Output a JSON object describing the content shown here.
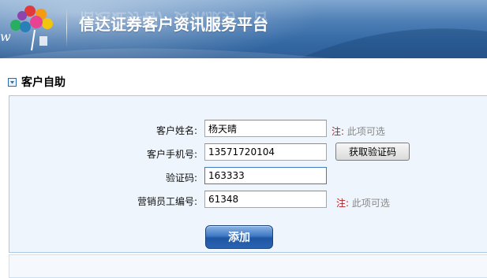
{
  "header": {
    "title": "信达证券客户资讯服务平台"
  },
  "section": {
    "title": "客户自助"
  },
  "form": {
    "name_label": "客户姓名:",
    "name_value": "杨天晴",
    "phone_label": "客户手机号:",
    "phone_value": "13571720104",
    "code_label": "验证码:",
    "code_value": "163333",
    "staff_label": "营销员工编号:",
    "staff_value": "61348",
    "note_prefix": "注:",
    "note_text": "此项可选",
    "get_code_button": "获取验证码",
    "submit_button": "添加"
  },
  "colors": {
    "header_blue": "#356aa5",
    "panel_bg": "#eef5fc",
    "note_red": "#b8181e"
  }
}
